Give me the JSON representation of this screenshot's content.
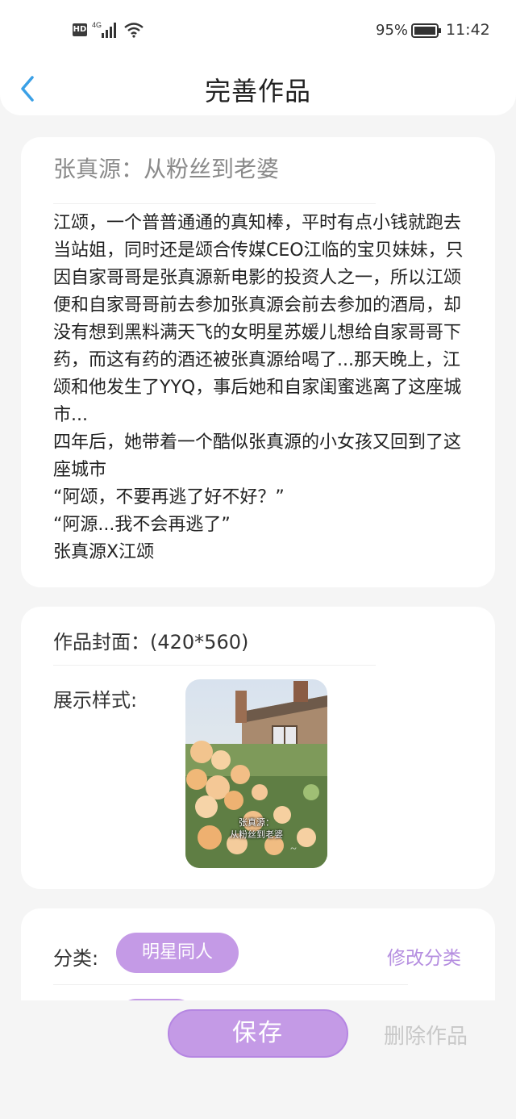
{
  "status_bar": {
    "hd": "HD",
    "network": "4G",
    "battery": "95%",
    "time": "11:42"
  },
  "header": {
    "title": "完善作品",
    "back_icon": "chevron-left-icon"
  },
  "work": {
    "title": "张真源：从粉丝到老婆",
    "description": "江颂，一个普普通通的真知棒，平时有点小钱就跑去当站姐，同时还是颂合传媒CEO江临的宝贝妹妹，只因自家哥哥是张真源新电影的投资人之一，所以江颂便和自家哥哥前去参加张真源会前去参加的酒局，却没有想到黑料满天飞的女明星苏媛儿想给自家哥哥下药，而这有药的酒还被张真源给喝了...那天晚上，江颂和他发生了YYQ，事后她和自家闺蜜逃离了这座城市...\n四年后，她带着一个酷似张真源的小女孩又回到了这座城市\n“阿颂，不要再逃了好不好？”\n“阿源...我不会再逃了”\n张真源X江颂"
  },
  "cover": {
    "label": "作品封面：(420*560)",
    "display_label": "展示样式:",
    "caption_line1": "张真源：",
    "caption_line2": "从粉丝到老婆"
  },
  "category": {
    "label": "分类:",
    "value": "明星同人",
    "change_label": "修改分类"
  },
  "actions": {
    "save_label": "保存",
    "delete_label": "删除作品"
  },
  "colors": {
    "accent": "#c49ae6",
    "accent_text": "#b58ee0",
    "back_icon": "#3aa0e6"
  }
}
